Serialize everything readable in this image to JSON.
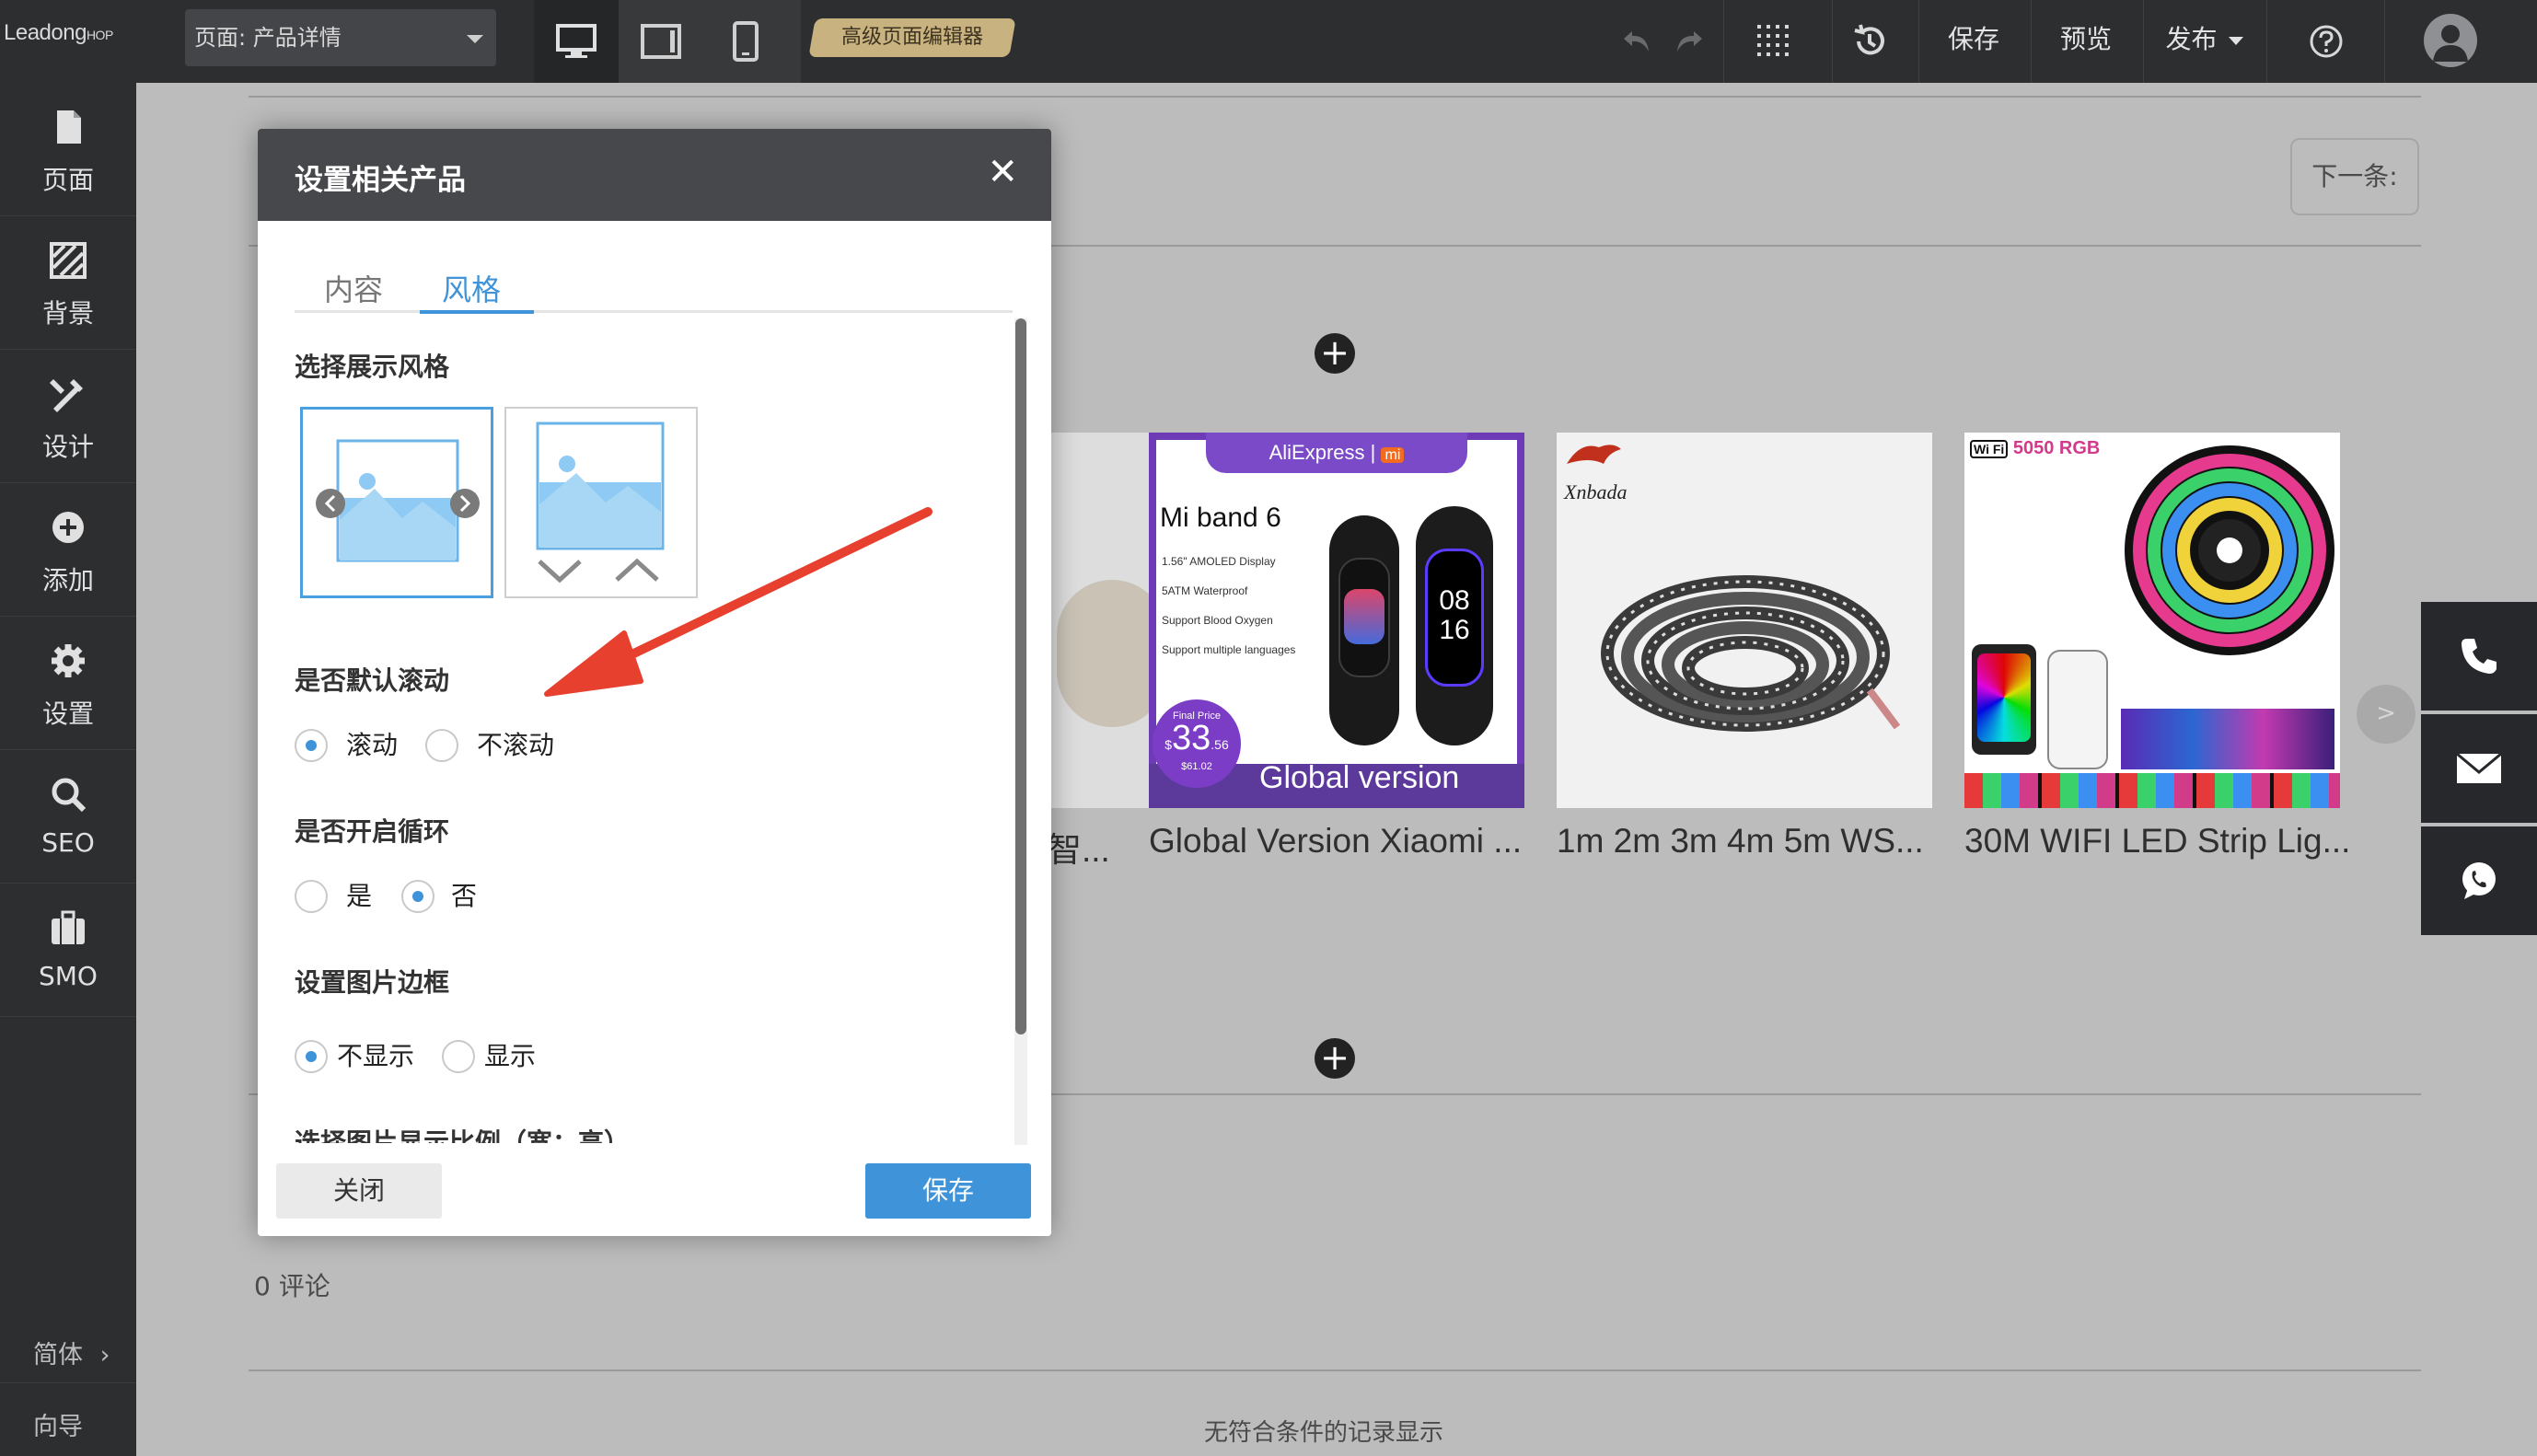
{
  "topbar": {
    "logo_main": "Leadong",
    "logo_tail": "HOP",
    "page_select": "页面:  产品详情",
    "advanced_editor": "高级页面编辑器",
    "save": "保存",
    "preview": "预览",
    "publish": "发布"
  },
  "sidebar": {
    "items": [
      {
        "label": "页面",
        "icon": "page-icon"
      },
      {
        "label": "背景",
        "icon": "background-icon"
      },
      {
        "label": "设计",
        "icon": "design-icon"
      },
      {
        "label": "添加",
        "icon": "add-icon"
      },
      {
        "label": "设置",
        "icon": "gear-icon"
      },
      {
        "label": "SEO",
        "icon": "search-icon"
      },
      {
        "label": "SMO",
        "icon": "briefcase-icon"
      }
    ],
    "language": "简体",
    "guide": "向导"
  },
  "page": {
    "next_button": "下一条:",
    "partial_title": "智...",
    "products": [
      {
        "title": "Global Version Xiaomi ...",
        "brand": "AliExpress",
        "model": "Mi band 6",
        "specs": [
          "1.56\" AMOLED Display",
          "5ATM Waterproof",
          "Support Blood Oxygen",
          "Support multiple languages"
        ],
        "final_price_label": "Final Price",
        "price_currency": "$",
        "price_main": "33",
        "price_cents": ".56",
        "price_old": "$61.02",
        "banner": "Global version",
        "watch_time_hh": "08",
        "watch_time_mm": "16"
      },
      {
        "title": "1m 2m 3m 4m 5m WS...",
        "brand": "Xnbada"
      },
      {
        "title": "30M WIFI LED Strip Lig...",
        "brand": "5050 RGB",
        "brand_badge": "Wi Fi"
      }
    ],
    "carousel_next": ">",
    "comments": "0  评论",
    "no_records": "无符合条件的记录显示"
  },
  "modal": {
    "title": "设置相关产品",
    "close": "✕",
    "tabs": [
      "内容",
      "风格"
    ],
    "active_tab": "风格",
    "section_style": "选择展示风格",
    "section_autoscroll": "是否默认滚动",
    "autoscroll_options": [
      "滚动",
      "不滚动"
    ],
    "autoscroll_selected": "滚动",
    "section_loop": "是否开启循环",
    "loop_options": [
      "是",
      "否"
    ],
    "loop_selected": "否",
    "section_border": "设置图片边框",
    "border_options": [
      "不显示",
      "显示"
    ],
    "border_selected": "不显示",
    "section_ratio": "选择图片显示比例（宽：高）",
    "btn_close": "关闭",
    "btn_save": "保存"
  },
  "colors": {
    "accent": "#3f93d8",
    "topbar": "#2d2e30",
    "annotation_arrow": "#e8402f",
    "advanced_badge": "#c8b27f"
  }
}
